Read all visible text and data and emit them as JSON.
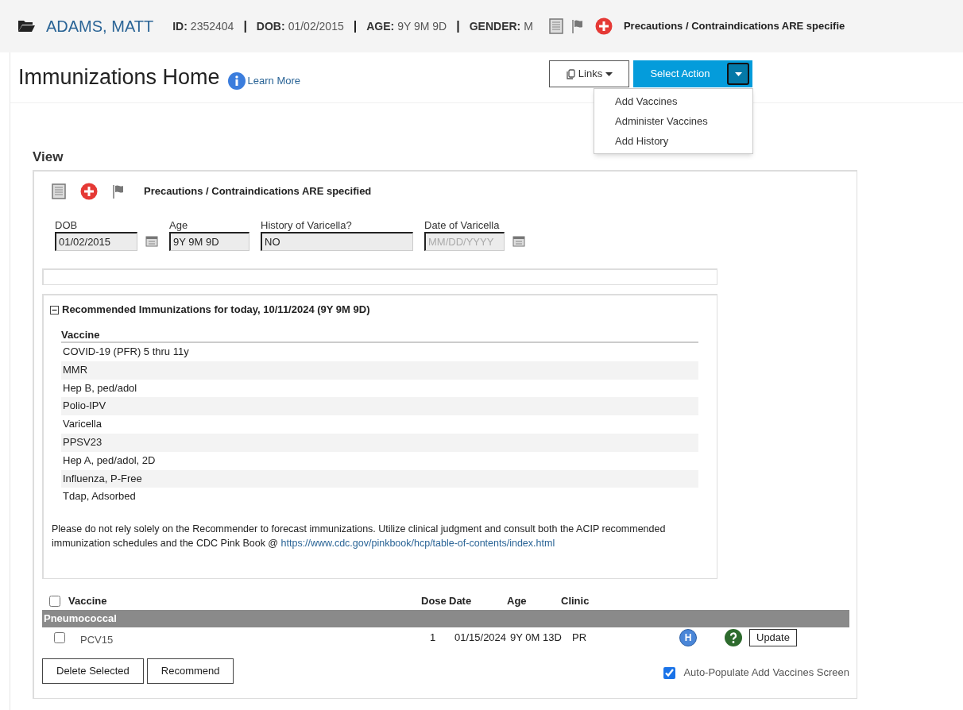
{
  "patient_header": {
    "name": "ADAMS, MATT",
    "fields": [
      {
        "label": "ID:",
        "value": "2352404"
      },
      {
        "label": "DOB:",
        "value": "01/02/2015"
      },
      {
        "label": "AGE:",
        "value": "9Y 9M 9D"
      },
      {
        "label": "GENDER:",
        "value": "M"
      }
    ],
    "separator": "|",
    "alert": "Precautions / Contraindications ARE specifie"
  },
  "page_title": "Immunizations Home",
  "learn_more": "Learn More",
  "links_button": "Links",
  "select_action": "Select Action",
  "action_menu": {
    "expanded": true,
    "items": [
      "Add Vaccines",
      "Administer Vaccines",
      "Add History"
    ]
  },
  "view": {
    "heading": "View",
    "alert": "Precautions / Contraindications ARE specified",
    "fields": [
      {
        "label": "DOB",
        "value": "01/02/2015",
        "calendar": true
      },
      {
        "label": "Age",
        "value": "9Y 9M 9D",
        "calendar": false
      },
      {
        "label": "History of Varicella?",
        "value": "NO",
        "calendar": false
      },
      {
        "label": "Date of Varicella",
        "placeholder": "MM/DD/YYYY",
        "calendar": true
      }
    ]
  },
  "recommended": {
    "expanded": true,
    "title": "Recommended Immunizations for today, 10/11/2024 (9Y 9M 9D)",
    "column": "Vaccine",
    "rows": [
      "COVID-19 (PFR) 5 thru 11y",
      "MMR",
      "Hep B, ped/adol",
      "Polio-IPV",
      "Varicella",
      "PPSV23",
      "Hep A, ped/adol, 2D",
      "Influenza, P-Free",
      "Tdap, Adsorbed"
    ],
    "note": "Please do not rely solely on the Recommender to forecast immunizations. Utilize clinical judgment and consult both the ACIP recommended immunization schedules and the CDC Pink Book @ ",
    "link": "https://www.cdc.gov/pinkbook/hcp/table-of-contents/index.html"
  },
  "history_table": {
    "select_all_checked": false,
    "columns": [
      "Vaccine",
      "Dose",
      "Date",
      "Age",
      "Clinic"
    ],
    "groups": [
      {
        "name": "Pneumococcal",
        "rows": [
          {
            "checked": false,
            "vaccine": "PCV15",
            "dose": "1",
            "date": "01/15/2024",
            "age": "9Y 0M 13D",
            "clinic": "PR",
            "badge": "H",
            "update": "Update"
          }
        ]
      }
    ]
  },
  "buttons": [
    "Delete Selected",
    "Recommend"
  ],
  "auto_populate": {
    "label": "Auto-Populate Add Vaccines Screen",
    "checked": true
  }
}
